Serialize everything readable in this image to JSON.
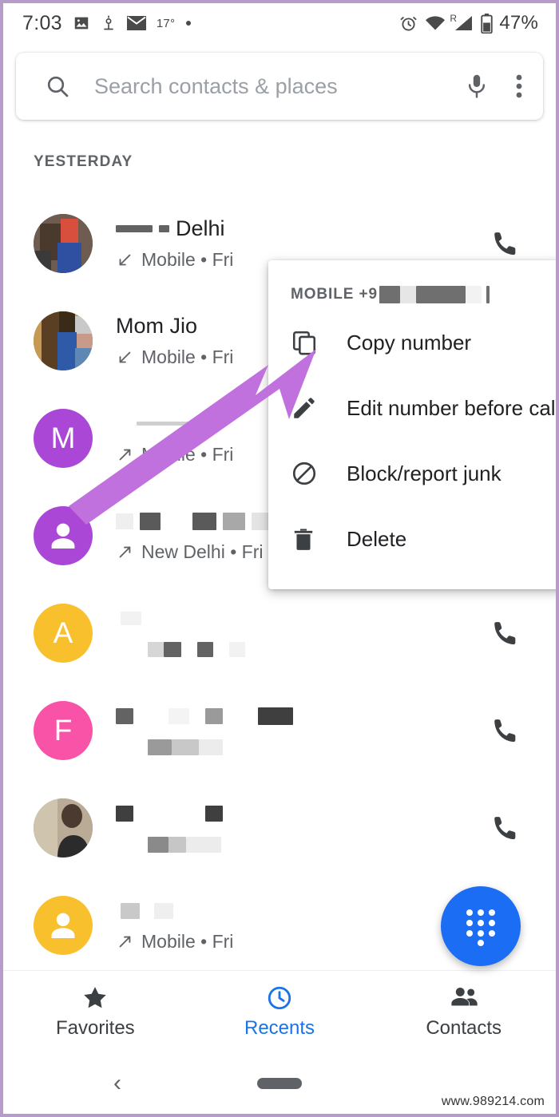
{
  "status_bar": {
    "time": "7:03",
    "temperature": "17°",
    "battery_percent": "47%",
    "icons_left": [
      "image-icon",
      "location-pin-icon",
      "envelope-icon",
      "dot-icon"
    ],
    "icons_right": [
      "alarm-clock-icon",
      "wifi-icon",
      "roaming-signal-icon",
      "battery-icon"
    ]
  },
  "search": {
    "placeholder": "Search contacts & places",
    "value": "",
    "search_icon": "search-icon",
    "mic_icon": "microphone-icon",
    "overflow_icon": "more-vertical-icon"
  },
  "list": {
    "section_header": "YESTERDAY",
    "rows": [
      {
        "avatar_type": "photo",
        "avatar_color": "#8d6e63",
        "avatar_letter": "",
        "name_redacted": true,
        "name_visible": "Delhi",
        "direction_icon": "incoming-call-icon",
        "subtitle": "Mobile • Fri",
        "has_call_button": true
      },
      {
        "avatar_type": "photo",
        "avatar_color": "#7b5e3b",
        "avatar_letter": "",
        "name_redacted": false,
        "name_visible": "Mom Jio",
        "direction_icon": "incoming-call-icon",
        "subtitle": "Mobile • Fri",
        "has_call_button": false
      },
      {
        "avatar_type": "letter",
        "avatar_color": "#ab47d6",
        "avatar_letter": "M",
        "name_redacted": true,
        "name_visible": "",
        "direction_icon": "outgoing-call-icon",
        "subtitle": "Mobile • Fri",
        "has_call_button": false
      },
      {
        "avatar_type": "person",
        "avatar_color": "#ab47d6",
        "avatar_letter": "",
        "name_redacted": true,
        "name_visible": "",
        "direction_icon": "outgoing-call-icon",
        "subtitle": "New Delhi • Fri",
        "has_call_button": false
      },
      {
        "avatar_type": "letter",
        "avatar_color": "#f9c02d",
        "avatar_letter": "A",
        "name_redacted": true,
        "name_visible": "",
        "direction_icon": "",
        "subtitle": "",
        "has_call_button": true
      },
      {
        "avatar_type": "letter",
        "avatar_color": "#f953a8",
        "avatar_letter": "F",
        "name_redacted": true,
        "name_visible": "",
        "direction_icon": "",
        "subtitle": "",
        "has_call_button": true
      },
      {
        "avatar_type": "photo",
        "avatar_color": "#a39582",
        "avatar_letter": "",
        "name_redacted": true,
        "name_visible": "",
        "direction_icon": "",
        "subtitle": "",
        "has_call_button": true
      },
      {
        "avatar_type": "person",
        "avatar_color": "#f9c02d",
        "avatar_letter": "",
        "name_redacted": true,
        "name_visible": "",
        "direction_icon": "outgoing-call-icon",
        "subtitle": "Mobile • Fri",
        "has_call_button": false
      }
    ]
  },
  "context_menu": {
    "header_prefix": "MOBILE +9",
    "header_redacted": true,
    "items": [
      {
        "label": "Copy number",
        "icon": "copy-icon"
      },
      {
        "label": "Edit number before call",
        "icon": "pencil-icon"
      },
      {
        "label": "Block/report junk",
        "icon": "block-icon"
      },
      {
        "label": "Delete",
        "icon": "trash-icon"
      }
    ]
  },
  "fab": {
    "icon": "dialpad-icon",
    "color": "#1b6ef3"
  },
  "bottom_nav": {
    "tabs": [
      {
        "label": "Favorites",
        "icon": "star-icon",
        "active": false
      },
      {
        "label": "Recents",
        "icon": "clock-icon",
        "active": true
      },
      {
        "label": "Contacts",
        "icon": "people-icon",
        "active": false
      }
    ],
    "active_color": "#1a73e8"
  },
  "system_nav": {
    "back_icon": "chevron-left-icon",
    "home_pill": "home-pill"
  },
  "annotation": {
    "arrow_color": "#c071dd",
    "points_to": "Copy number"
  },
  "watermark": "www.989214.com",
  "colors": {
    "frame_border": "#b79bc9",
    "accent_blue": "#1a73e8",
    "purple_avatar": "#ab47d6",
    "yellow_avatar": "#f9c02d",
    "pink_avatar": "#f953a8"
  }
}
